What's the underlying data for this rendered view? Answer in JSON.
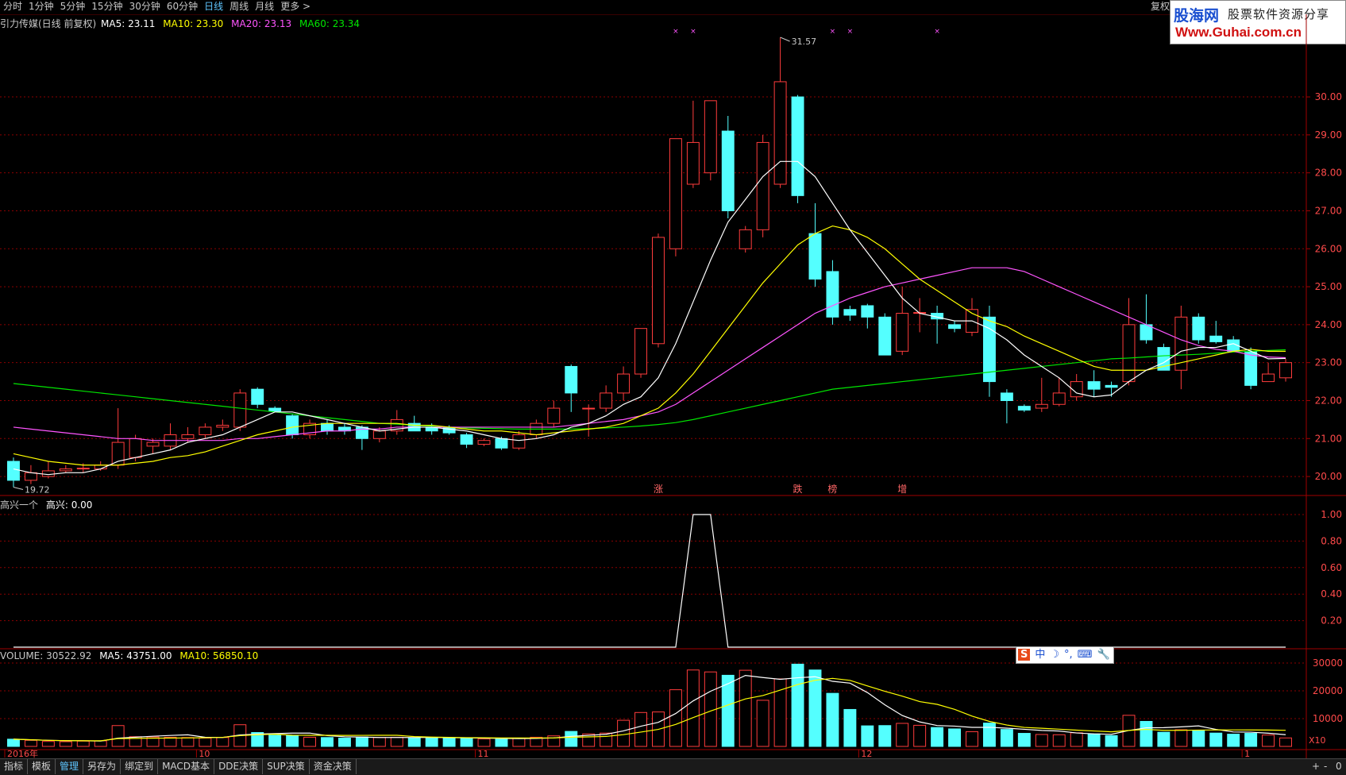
{
  "topbar": {
    "tabs": [
      "分时",
      "1分钟",
      "5分钟",
      "15分钟",
      "30分钟",
      "60分钟",
      "日线",
      "周线",
      "月线",
      "更多 >"
    ],
    "active_index": 6,
    "fuquan_label": "复权"
  },
  "logo": {
    "name": "股海网",
    "slogan": "股票软件资源分享",
    "url": "Www.Guhai.com.cn"
  },
  "main_header": {
    "stock": "引力传媒(日线 前复权)",
    "ma5": "MA5: 23.11",
    "ma10": "MA10: 23.30",
    "ma20": "MA20: 23.13",
    "ma60": "MA60: 23.34"
  },
  "indicator_header": {
    "name": "高兴一个",
    "value": "高兴: 0.00"
  },
  "volume_header": {
    "volume": "VOLUME: 30522.92",
    "ma5": "MA5: 43751.00",
    "ma10": "MA10: 56850.10"
  },
  "bottombar": {
    "tabs": [
      "指标",
      "模板",
      "管理",
      "另存为",
      "绑定到",
      "MACD基本",
      "DDE决策",
      "SUP决策",
      "资金决策"
    ],
    "active_index": 2,
    "controls": [
      "+",
      "-",
      "0"
    ]
  },
  "ime": {
    "items": [
      "S",
      "中",
      "☽",
      "°,",
      "⌨",
      "🔧"
    ]
  },
  "colors": {
    "up": "#ff3c3c",
    "down": "#54ffff",
    "ma5": "#ffffff",
    "ma10": "#ffff00",
    "ma20": "#ff55ff",
    "ma60": "#00e600",
    "grid": "#8b0000",
    "axis_text": "#ff4a4a"
  },
  "chart_data": {
    "type": "candlestick",
    "y_ticks": [
      "30.00",
      "29.00",
      "28.00",
      "27.00",
      "26.00",
      "25.00",
      "24.00",
      "23.00",
      "22.00",
      "21.00",
      "20.00"
    ],
    "ylim": [
      19.5,
      31.8
    ],
    "high_label": "31.57",
    "low_label": "19.72",
    "x_labels": [
      "2016年",
      "10",
      "11",
      "12",
      "1"
    ],
    "x_label_index": [
      0,
      11,
      27,
      49,
      71
    ],
    "event_labels": [
      {
        "text": "涨",
        "index": 37
      },
      {
        "text": "跌",
        "index": 45
      },
      {
        "text": "榜",
        "index": 47
      },
      {
        "text": "增",
        "index": 51
      }
    ],
    "markers_top_index": [
      38,
      39,
      47,
      48,
      53
    ],
    "candles": [
      {
        "o": 20.4,
        "h": 20.5,
        "l": 19.72,
        "c": 19.9
      },
      {
        "o": 19.9,
        "h": 20.3,
        "l": 19.8,
        "c": 20.1
      },
      {
        "o": 20.0,
        "h": 20.4,
        "l": 19.95,
        "c": 20.15
      },
      {
        "o": 20.15,
        "h": 20.3,
        "l": 20.1,
        "c": 20.2
      },
      {
        "o": 20.2,
        "h": 20.35,
        "l": 20.1,
        "c": 20.22
      },
      {
        "o": 20.2,
        "h": 20.4,
        "l": 20.15,
        "c": 20.3
      },
      {
        "o": 20.3,
        "h": 21.8,
        "l": 20.2,
        "c": 20.9
      },
      {
        "o": 20.5,
        "h": 21.1,
        "l": 20.4,
        "c": 21.0
      },
      {
        "o": 20.8,
        "h": 21.0,
        "l": 20.6,
        "c": 20.9
      },
      {
        "o": 20.8,
        "h": 21.4,
        "l": 20.7,
        "c": 21.1
      },
      {
        "o": 21.0,
        "h": 21.3,
        "l": 20.9,
        "c": 21.1
      },
      {
        "o": 21.1,
        "h": 21.4,
        "l": 21.0,
        "c": 21.3
      },
      {
        "o": 21.3,
        "h": 21.5,
        "l": 21.2,
        "c": 21.35
      },
      {
        "o": 21.3,
        "h": 22.3,
        "l": 21.2,
        "c": 22.2
      },
      {
        "o": 22.3,
        "h": 22.35,
        "l": 21.8,
        "c": 21.9
      },
      {
        "o": 21.8,
        "h": 21.85,
        "l": 21.7,
        "c": 21.72
      },
      {
        "o": 21.6,
        "h": 21.65,
        "l": 21.0,
        "c": 21.1
      },
      {
        "o": 21.1,
        "h": 21.5,
        "l": 21.0,
        "c": 21.4
      },
      {
        "o": 21.4,
        "h": 21.5,
        "l": 21.1,
        "c": 21.2
      },
      {
        "o": 21.3,
        "h": 21.4,
        "l": 21.1,
        "c": 21.2
      },
      {
        "o": 21.3,
        "h": 21.35,
        "l": 20.7,
        "c": 21.0
      },
      {
        "o": 21.0,
        "h": 21.3,
        "l": 20.9,
        "c": 21.2
      },
      {
        "o": 21.2,
        "h": 21.75,
        "l": 21.1,
        "c": 21.5
      },
      {
        "o": 21.4,
        "h": 21.6,
        "l": 21.2,
        "c": 21.2
      },
      {
        "o": 21.3,
        "h": 21.4,
        "l": 21.1,
        "c": 21.2
      },
      {
        "o": 21.3,
        "h": 21.35,
        "l": 21.1,
        "c": 21.15
      },
      {
        "o": 21.1,
        "h": 21.15,
        "l": 20.75,
        "c": 20.85
      },
      {
        "o": 20.85,
        "h": 21.0,
        "l": 20.8,
        "c": 20.95
      },
      {
        "o": 21.0,
        "h": 21.05,
        "l": 20.7,
        "c": 20.75
      },
      {
        "o": 20.75,
        "h": 21.2,
        "l": 20.7,
        "c": 21.1
      },
      {
        "o": 21.1,
        "h": 21.5,
        "l": 21.0,
        "c": 21.4
      },
      {
        "o": 21.4,
        "h": 22.0,
        "l": 21.3,
        "c": 21.8
      },
      {
        "o": 22.9,
        "h": 22.95,
        "l": 21.7,
        "c": 22.2
      },
      {
        "o": 21.8,
        "h": 21.9,
        "l": 21.05,
        "c": 21.8
      },
      {
        "o": 21.8,
        "h": 22.4,
        "l": 21.7,
        "c": 22.2
      },
      {
        "o": 22.2,
        "h": 22.9,
        "l": 22.0,
        "c": 22.7
      },
      {
        "o": 22.7,
        "h": 23.9,
        "l": 22.6,
        "c": 23.9
      },
      {
        "o": 23.5,
        "h": 26.4,
        "l": 23.4,
        "c": 26.3
      },
      {
        "o": 26.0,
        "h": 28.9,
        "l": 25.8,
        "c": 28.9
      },
      {
        "o": 27.7,
        "h": 29.9,
        "l": 27.6,
        "c": 28.8
      },
      {
        "o": 28.0,
        "h": 29.9,
        "l": 27.8,
        "c": 29.9
      },
      {
        "o": 29.1,
        "h": 29.5,
        "l": 26.8,
        "c": 27.0
      },
      {
        "o": 26.0,
        "h": 26.6,
        "l": 25.9,
        "c": 26.5
      },
      {
        "o": 26.5,
        "h": 29.0,
        "l": 26.3,
        "c": 28.8
      },
      {
        "o": 27.7,
        "h": 31.57,
        "l": 27.6,
        "c": 30.4
      },
      {
        "o": 30.0,
        "h": 30.05,
        "l": 27.2,
        "c": 27.4
      },
      {
        "o": 26.4,
        "h": 27.2,
        "l": 25.0,
        "c": 25.2
      },
      {
        "o": 25.4,
        "h": 25.7,
        "l": 24.0,
        "c": 24.2
      },
      {
        "o": 24.4,
        "h": 24.5,
        "l": 24.1,
        "c": 24.25
      },
      {
        "o": 24.5,
        "h": 24.55,
        "l": 23.9,
        "c": 24.2
      },
      {
        "o": 24.2,
        "h": 24.3,
        "l": 23.2,
        "c": 23.2
      },
      {
        "o": 23.3,
        "h": 25.0,
        "l": 23.2,
        "c": 24.3
      },
      {
        "o": 24.3,
        "h": 24.7,
        "l": 23.8,
        "c": 24.32
      },
      {
        "o": 24.3,
        "h": 24.5,
        "l": 23.5,
        "c": 24.15
      },
      {
        "o": 24.0,
        "h": 24.1,
        "l": 23.8,
        "c": 23.9
      },
      {
        "o": 23.8,
        "h": 24.7,
        "l": 23.7,
        "c": 24.4
      },
      {
        "o": 24.2,
        "h": 24.5,
        "l": 22.1,
        "c": 22.5
      },
      {
        "o": 22.2,
        "h": 22.3,
        "l": 21.4,
        "c": 22.0
      },
      {
        "o": 21.85,
        "h": 21.9,
        "l": 21.7,
        "c": 21.75
      },
      {
        "o": 21.8,
        "h": 22.6,
        "l": 21.7,
        "c": 21.9
      },
      {
        "o": 21.9,
        "h": 22.6,
        "l": 21.85,
        "c": 22.2
      },
      {
        "o": 22.1,
        "h": 22.7,
        "l": 22.0,
        "c": 22.5
      },
      {
        "o": 22.5,
        "h": 22.8,
        "l": 22.1,
        "c": 22.3
      },
      {
        "o": 22.4,
        "h": 22.5,
        "l": 22.1,
        "c": 22.35
      },
      {
        "o": 22.5,
        "h": 24.7,
        "l": 22.4,
        "c": 24.0
      },
      {
        "o": 24.0,
        "h": 24.8,
        "l": 23.5,
        "c": 23.6
      },
      {
        "o": 23.4,
        "h": 23.5,
        "l": 22.8,
        "c": 22.8
      },
      {
        "o": 22.8,
        "h": 24.5,
        "l": 22.3,
        "c": 24.2
      },
      {
        "o": 24.2,
        "h": 24.3,
        "l": 23.5,
        "c": 23.6
      },
      {
        "o": 23.7,
        "h": 24.1,
        "l": 23.5,
        "c": 23.55
      },
      {
        "o": 23.6,
        "h": 23.7,
        "l": 23.3,
        "c": 23.3
      },
      {
        "o": 23.3,
        "h": 23.4,
        "l": 22.3,
        "c": 22.4
      },
      {
        "o": 22.5,
        "h": 23.0,
        "l": 22.5,
        "c": 22.7
      },
      {
        "o": 22.6,
        "h": 23.1,
        "l": 22.5,
        "c": 23.0
      }
    ],
    "ma5": [
      20.2,
      20.1,
      20.05,
      20.1,
      20.1,
      20.2,
      20.4,
      20.5,
      20.6,
      20.7,
      20.9,
      21.0,
      21.1,
      21.3,
      21.5,
      21.7,
      21.7,
      21.6,
      21.5,
      21.4,
      21.3,
      21.2,
      21.25,
      21.3,
      21.3,
      21.25,
      21.2,
      21.1,
      21.0,
      20.95,
      21.0,
      21.1,
      21.3,
      21.4,
      21.6,
      21.9,
      22.1,
      22.6,
      23.5,
      24.6,
      25.7,
      26.7,
      27.3,
      27.9,
      28.3,
      28.3,
      27.9,
      27.2,
      26.5,
      25.9,
      25.3,
      24.7,
      24.3,
      24.2,
      24.1,
      24.1,
      23.9,
      23.6,
      23.2,
      22.9,
      22.6,
      22.2,
      22.1,
      22.15,
      22.5,
      22.8,
      23.0,
      23.3,
      23.4,
      23.4,
      23.5,
      23.3,
      23.1,
      23.11
    ],
    "ma10": [
      20.6,
      20.5,
      20.4,
      20.35,
      20.3,
      20.3,
      20.3,
      20.35,
      20.4,
      20.5,
      20.55,
      20.65,
      20.8,
      20.95,
      21.1,
      21.2,
      21.3,
      21.35,
      21.4,
      21.4,
      21.4,
      21.4,
      21.4,
      21.35,
      21.35,
      21.3,
      21.25,
      21.2,
      21.2,
      21.15,
      21.1,
      21.15,
      21.2,
      21.25,
      21.3,
      21.4,
      21.6,
      21.8,
      22.2,
      22.7,
      23.3,
      23.9,
      24.5,
      25.1,
      25.6,
      26.1,
      26.4,
      26.6,
      26.5,
      26.3,
      26.0,
      25.6,
      25.2,
      24.9,
      24.6,
      24.3,
      24.1,
      23.95,
      23.7,
      23.5,
      23.3,
      23.1,
      22.9,
      22.8,
      22.8,
      22.8,
      22.9,
      23.0,
      23.1,
      23.2,
      23.3,
      23.35,
      23.3,
      23.3
    ],
    "ma20": [
      21.3,
      21.25,
      21.2,
      21.15,
      21.1,
      21.05,
      21.0,
      21.0,
      20.95,
      20.95,
      20.95,
      20.95,
      20.95,
      21.0,
      21.0,
      21.05,
      21.1,
      21.15,
      21.2,
      21.2,
      21.25,
      21.25,
      21.3,
      21.3,
      21.3,
      21.3,
      21.3,
      21.3,
      21.3,
      21.3,
      21.3,
      21.3,
      21.35,
      21.4,
      21.45,
      21.5,
      21.6,
      21.7,
      21.9,
      22.2,
      22.5,
      22.8,
      23.1,
      23.4,
      23.7,
      24.0,
      24.3,
      24.5,
      24.7,
      24.85,
      25.0,
      25.1,
      25.2,
      25.3,
      25.4,
      25.5,
      25.5,
      25.5,
      25.4,
      25.2,
      25.0,
      24.8,
      24.6,
      24.4,
      24.2,
      24.0,
      23.8,
      23.6,
      23.45,
      23.35,
      23.3,
      23.2,
      23.15,
      23.13
    ],
    "ma60": [
      22.45,
      22.4,
      22.35,
      22.3,
      22.25,
      22.2,
      22.15,
      22.1,
      22.05,
      22.0,
      21.95,
      21.9,
      21.85,
      21.8,
      21.75,
      21.7,
      21.65,
      21.6,
      21.55,
      21.5,
      21.45,
      21.4,
      21.38,
      21.35,
      21.33,
      21.3,
      21.28,
      21.27,
      21.26,
      21.25,
      21.25,
      21.25,
      21.25,
      21.26,
      21.28,
      21.3,
      21.33,
      21.37,
      21.42,
      21.5,
      21.6,
      21.7,
      21.8,
      21.9,
      22.0,
      22.1,
      22.2,
      22.3,
      22.35,
      22.4,
      22.45,
      22.5,
      22.55,
      22.6,
      22.65,
      22.7,
      22.75,
      22.8,
      22.85,
      22.9,
      22.95,
      23.0,
      23.05,
      23.1,
      23.12,
      23.15,
      23.18,
      23.2,
      23.22,
      23.25,
      23.28,
      23.3,
      23.32,
      23.34
    ],
    "indicator": {
      "name": "高兴",
      "y_ticks": [
        "1.00",
        "0.80",
        "0.60",
        "0.40",
        "0.20"
      ],
      "ylim": [
        0,
        1.0
      ],
      "values": [
        0,
        0,
        0,
        0,
        0,
        0,
        0,
        0,
        0,
        0,
        0,
        0,
        0,
        0,
        0,
        0,
        0,
        0,
        0,
        0,
        0,
        0,
        0,
        0,
        0,
        0,
        0,
        0,
        0,
        0,
        0,
        0,
        0,
        0,
        0,
        0,
        0,
        0,
        0,
        1,
        1,
        0,
        0,
        0,
        0,
        0,
        0,
        0,
        0,
        0,
        0,
        0,
        0,
        0,
        0,
        0,
        0,
        0,
        0,
        0,
        0,
        0,
        0,
        0,
        0,
        0,
        0,
        0,
        0,
        0,
        0,
        0,
        0,
        0
      ]
    },
    "volume": {
      "y_ticks": [
        "30000",
        "20000",
        "10000"
      ],
      "ylim": [
        0,
        32000
      ],
      "scale_label": "X10",
      "values": [
        2600,
        2200,
        1800,
        1700,
        1900,
        2000,
        7500,
        3500,
        3400,
        3300,
        3200,
        3000,
        3200,
        7800,
        5000,
        4000,
        3900,
        3300,
        3200,
        3000,
        3400,
        3200,
        3300,
        3100,
        3200,
        3000,
        2900,
        2700,
        2600,
        2900,
        3300,
        3800,
        5400,
        4500,
        4800,
        9400,
        12200,
        12400,
        20400,
        27500,
        26800,
        25600,
        27400,
        16600,
        24300,
        29600,
        27500,
        19100,
        13300,
        7400,
        7500,
        8300,
        7600,
        6800,
        6300,
        5300,
        8400,
        6100,
        4700,
        4300,
        4200,
        4900,
        4500,
        3900,
        11200,
        9000,
        5100,
        6000,
        5700,
        4800,
        4400,
        4700,
        4100,
        3052
      ]
    }
  }
}
